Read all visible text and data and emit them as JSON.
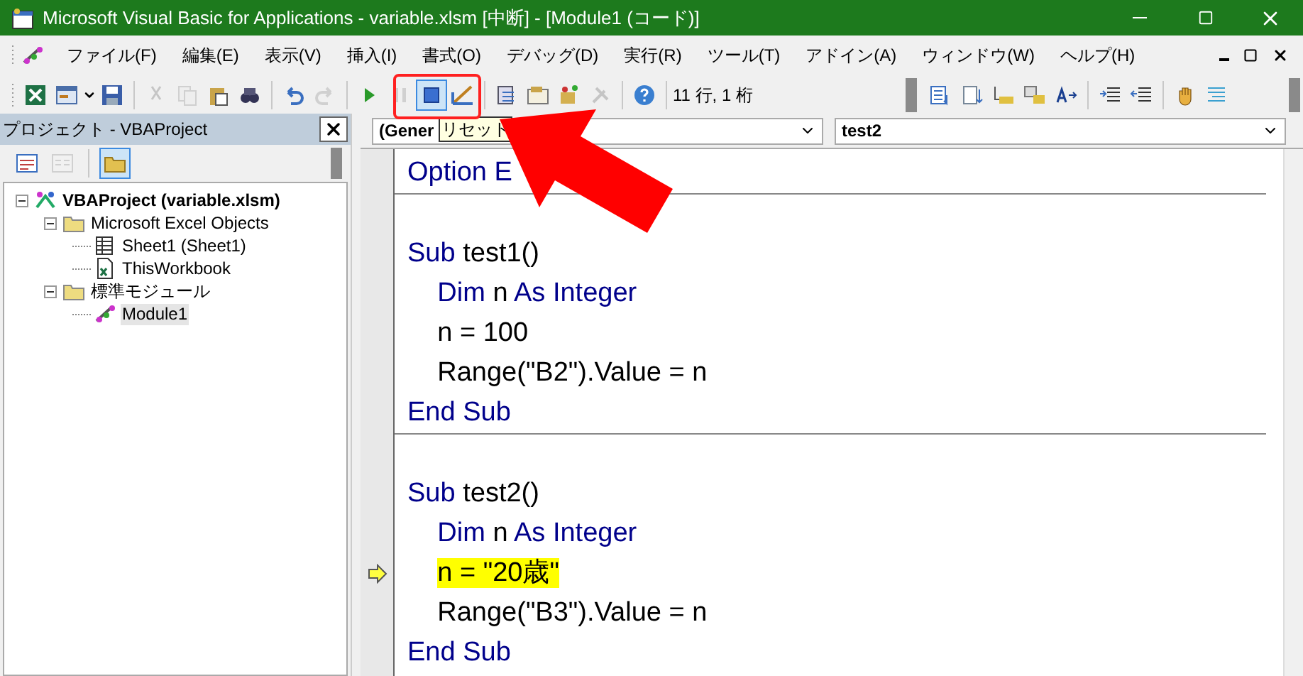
{
  "window": {
    "title": "Microsoft Visual Basic for Applications - variable.xlsm [中断] - [Module1 (コード)]"
  },
  "menu": [
    "ファイル(F)",
    "編集(E)",
    "表示(V)",
    "挿入(I)",
    "書式(O)",
    "デバッグ(D)",
    "実行(R)",
    "ツール(T)",
    "アドイン(A)",
    "ウィンドウ(W)",
    "ヘルプ(H)"
  ],
  "toolbar": {
    "buttons": [
      {
        "kind": "excel",
        "disabled": false,
        "selected": false
      },
      {
        "kind": "form",
        "disabled": false,
        "selected": false
      },
      {
        "kind": "save",
        "disabled": false,
        "selected": false
      },
      {
        "kind": "cut",
        "disabled": true,
        "selected": false
      },
      {
        "kind": "copy",
        "disabled": true,
        "selected": false
      },
      {
        "kind": "paste",
        "disabled": false,
        "selected": false
      },
      {
        "kind": "find",
        "disabled": false,
        "selected": false
      },
      {
        "kind": "undo",
        "disabled": false,
        "selected": false
      },
      {
        "kind": "redo",
        "disabled": true,
        "selected": false
      },
      {
        "kind": "run",
        "disabled": false,
        "selected": false
      },
      {
        "kind": "pause",
        "disabled": true,
        "selected": false
      },
      {
        "kind": "stop",
        "disabled": false,
        "selected": true
      },
      {
        "kind": "design",
        "disabled": false,
        "selected": false
      },
      {
        "kind": "explorer",
        "disabled": false,
        "selected": false
      },
      {
        "kind": "properties",
        "disabled": false,
        "selected": false
      },
      {
        "kind": "browser",
        "disabled": false,
        "selected": false
      },
      {
        "kind": "tools",
        "disabled": true,
        "selected": false
      },
      {
        "kind": "help",
        "disabled": false,
        "selected": false
      }
    ],
    "position": "11 行, 1 桁",
    "edit_buttons": [
      {
        "kind": "list",
        "disabled": false
      },
      {
        "kind": "list2",
        "disabled": false
      },
      {
        "kind": "info",
        "disabled": false
      },
      {
        "kind": "info2",
        "disabled": false
      },
      {
        "kind": "word",
        "disabled": false
      },
      {
        "kind": "indent",
        "disabled": false
      },
      {
        "kind": "outdent",
        "disabled": false
      },
      {
        "kind": "hand",
        "disabled": false
      },
      {
        "kind": "comment",
        "disabled": false
      }
    ]
  },
  "project_panel": {
    "title": "プロジェクト - VBAProject",
    "buttons": [
      {
        "kind": "code",
        "disabled": false,
        "selected": false
      },
      {
        "kind": "object",
        "disabled": true,
        "selected": false
      },
      {
        "kind": "folder",
        "disabled": false,
        "selected": true
      }
    ],
    "tree": [
      {
        "label": "VBAProject (variable.xlsm)",
        "kind": "project",
        "expanded": true,
        "selected": false,
        "children": [
          {
            "label": "Microsoft Excel Objects",
            "kind": "folder",
            "expanded": true,
            "selected": false,
            "children": [
              {
                "label": "Sheet1 (Sheet1)",
                "kind": "sheet",
                "selected": false
              },
              {
                "label": "ThisWorkbook",
                "kind": "workbook",
                "selected": false
              }
            ]
          },
          {
            "label": "標準モジュール",
            "kind": "folder",
            "expanded": true,
            "selected": false,
            "children": [
              {
                "label": "Module1",
                "kind": "module",
                "selected": true
              }
            ]
          }
        ]
      }
    ]
  },
  "code_window": {
    "object_combo": "(Gener",
    "procedure_combo": "test2",
    "lines": [
      {
        "kind": "code",
        "current": false,
        "segments": [
          {
            "text": "Option E",
            "keyword": true
          }
        ]
      },
      {
        "kind": "separator"
      },
      {
        "kind": "blank"
      },
      {
        "kind": "code",
        "current": false,
        "segments": [
          {
            "text": "Sub",
            "keyword": true
          },
          {
            "text": " test1()",
            "keyword": false
          }
        ]
      },
      {
        "kind": "code",
        "current": false,
        "segments": [
          {
            "text": "    Dim",
            "keyword": true
          },
          {
            "text": " n ",
            "keyword": false
          },
          {
            "text": "As Integer",
            "keyword": true
          }
        ]
      },
      {
        "kind": "code",
        "current": false,
        "segments": [
          {
            "text": "    n = 100",
            "keyword": false
          }
        ]
      },
      {
        "kind": "code",
        "current": false,
        "segments": [
          {
            "text": "    Range(\"B2\").Value = n",
            "keyword": false
          }
        ]
      },
      {
        "kind": "code",
        "current": false,
        "segments": [
          {
            "text": "End Sub",
            "keyword": true
          }
        ]
      },
      {
        "kind": "separator"
      },
      {
        "kind": "blank"
      },
      {
        "kind": "code",
        "current": false,
        "segments": [
          {
            "text": "Sub",
            "keyword": true
          },
          {
            "text": " test2()",
            "keyword": false
          }
        ]
      },
      {
        "kind": "code",
        "current": false,
        "segments": [
          {
            "text": "    Dim",
            "keyword": true
          },
          {
            "text": " n ",
            "keyword": false
          },
          {
            "text": "As Integer",
            "keyword": true
          }
        ]
      },
      {
        "kind": "code",
        "current": true,
        "segments": [
          {
            "text": "    n = \"20歳\"",
            "keyword": false
          }
        ]
      },
      {
        "kind": "code",
        "current": false,
        "segments": [
          {
            "text": "    Range(\"B3\").Value = n",
            "keyword": false
          }
        ]
      },
      {
        "kind": "code",
        "current": false,
        "segments": [
          {
            "text": "End Sub",
            "keyword": true
          }
        ]
      }
    ]
  },
  "tooltip": "リセット"
}
